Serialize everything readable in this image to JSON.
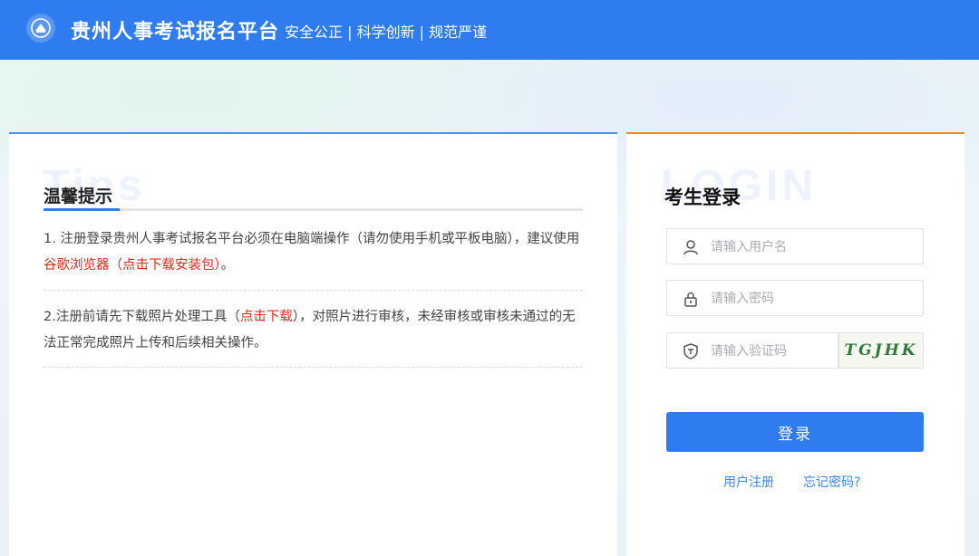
{
  "header": {
    "title": "贵州人事考试报名平台",
    "slogan": "安全公正 | 科学创新 | 规范严谨",
    "background": "#2f7cf0"
  },
  "tips": {
    "watermark": "Tips",
    "title": "温馨提示",
    "item1": {
      "text_a": "1. 注册登录贵州人事考试报名平台必须在电脑端操作（请勿使用手机或平板电脑），建议使用",
      "link": "谷歌浏览器（点击下载安装包）",
      "text_b": "。"
    },
    "item2": {
      "text_a": "2.注册前请先下载照片处理工具（",
      "link": "点击下载",
      "text_b": "），对照片进行审核，未经审核或审核未通过的无法正常完成照片上传和后续相关操作。"
    },
    "accent_color": "#e8291b"
  },
  "login": {
    "watermark": "LOGIN",
    "title": "考生登录",
    "username_placeholder": "请输入用户名",
    "password_placeholder": "请输入密码",
    "captcha_placeholder": "请输入验证码",
    "captcha_text": "TGJHK",
    "login_button": "登录",
    "register_link": "用户注册",
    "forgot_link": "忘记密码?",
    "button_color": "#2f7cf0",
    "accent_border": "#f08a24"
  },
  "icons": {
    "logo": "emblem-logo-icon",
    "username": "user-icon",
    "password": "lock-icon",
    "captcha": "shield-icon"
  }
}
